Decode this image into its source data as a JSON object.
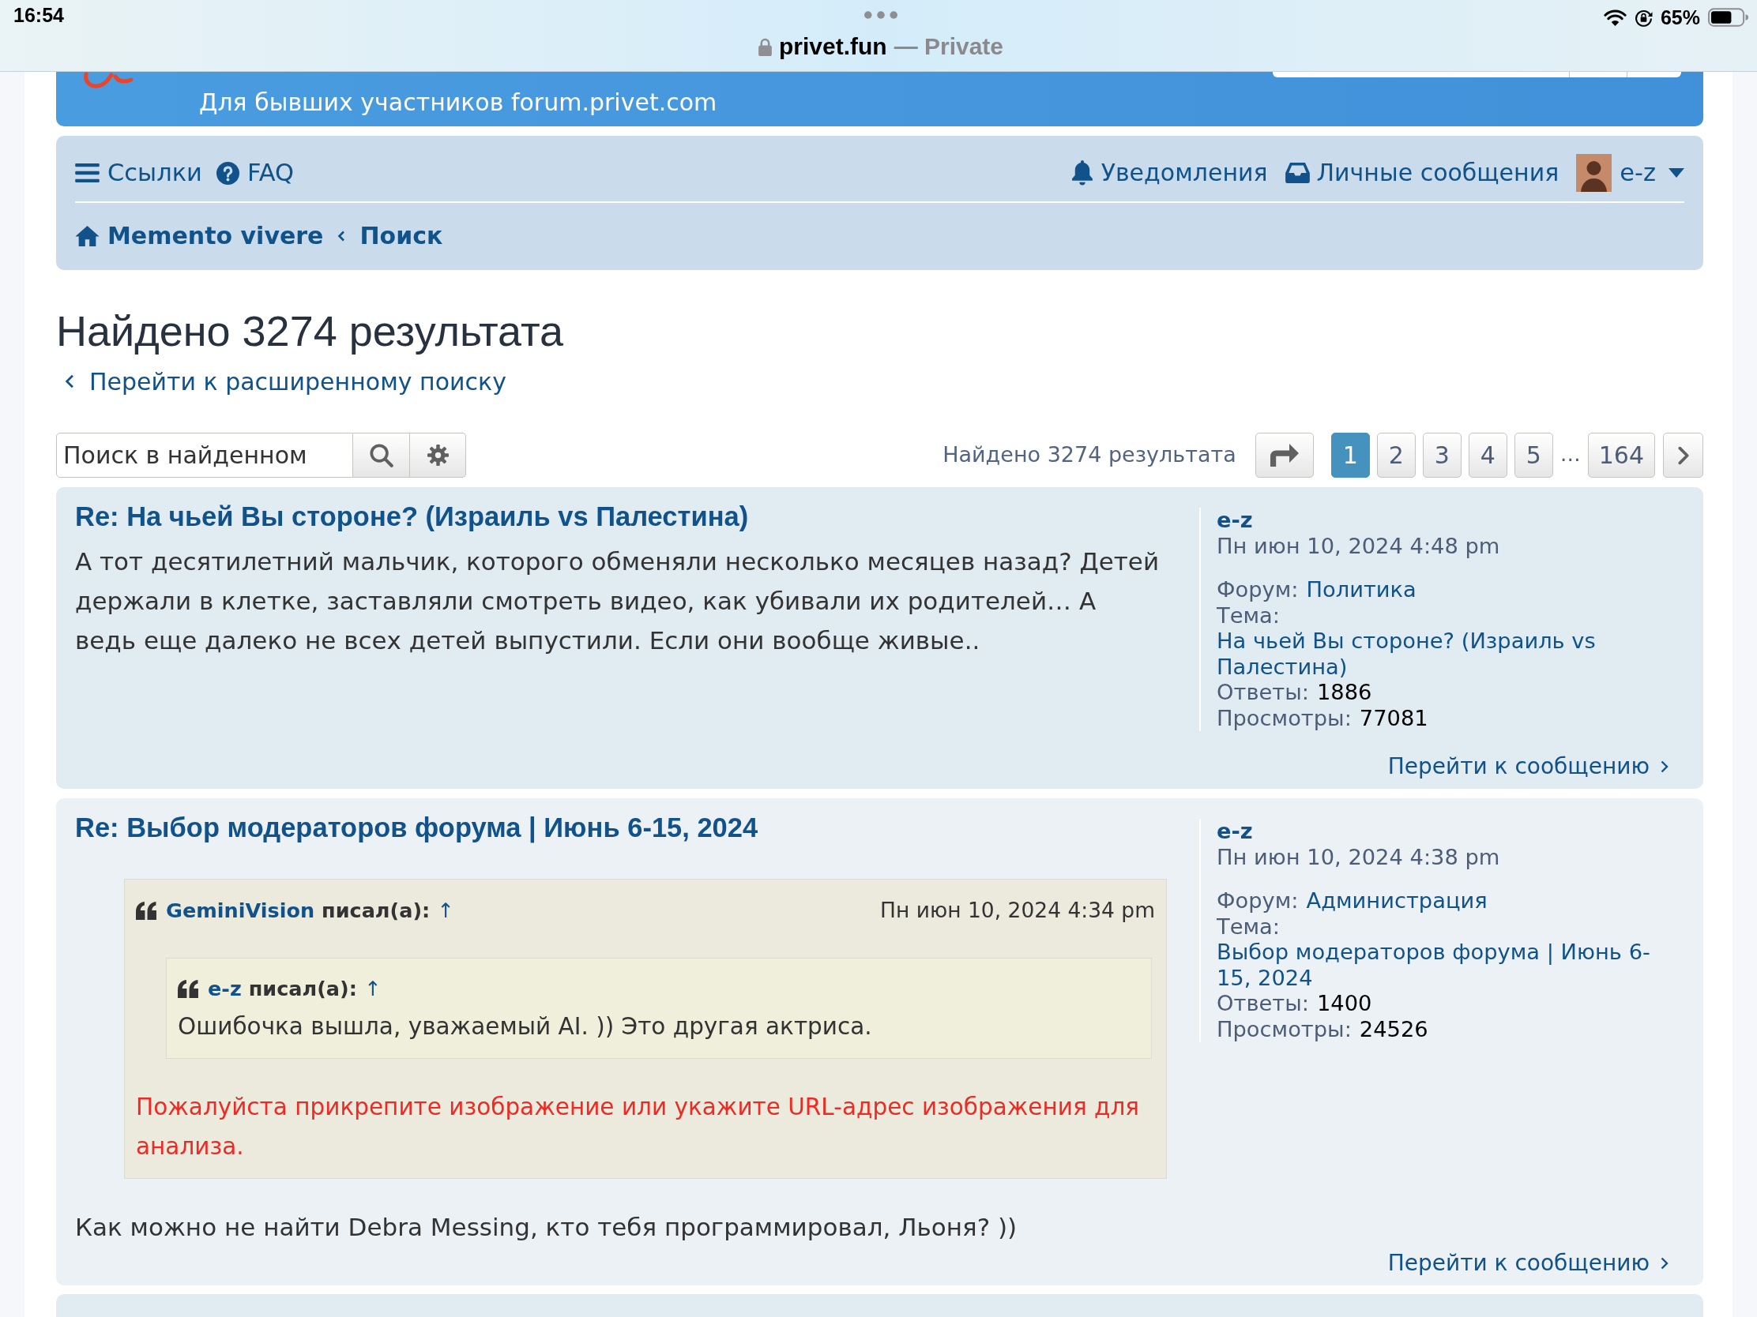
{
  "status_bar": {
    "time": "16:54",
    "battery": "65%"
  },
  "address_bar": {
    "domain": "privet.fun",
    "suffix": "— Private"
  },
  "header": {
    "tagline": "Для бывших участников forum.privet.com"
  },
  "navbar": {
    "left": [
      {
        "label": "Ссылки"
      },
      {
        "label": "FAQ"
      }
    ],
    "right": [
      {
        "label": "Уведомления"
      },
      {
        "label": "Личные сообщения"
      }
    ],
    "user": {
      "name": "e-z"
    },
    "breadcrumbs": [
      {
        "label": "Memento vivere"
      },
      {
        "label": "Поиск"
      }
    ]
  },
  "page": {
    "title": "Найдено 3274 результата",
    "advanced_search": "Перейти к расширенному поиску"
  },
  "search": {
    "placeholder": "Поиск в найденном"
  },
  "pagination": {
    "summary": "Найдено 3274 результата",
    "items": [
      {
        "kind": "page",
        "label": "1",
        "selected": true
      },
      {
        "kind": "page",
        "label": "2",
        "selected": false
      },
      {
        "kind": "page",
        "label": "3",
        "selected": false
      },
      {
        "kind": "page",
        "label": "4",
        "selected": false
      },
      {
        "kind": "page",
        "label": "5",
        "selected": false
      },
      {
        "kind": "ellipsis",
        "label": "…"
      },
      {
        "kind": "page",
        "label": "164",
        "selected": false
      }
    ]
  },
  "results": [
    {
      "title": "Re: На чьей Вы стороне? (Израиль vs Палестина)",
      "body": [
        {
          "kind": "text",
          "text": "А тот десятилетний мальчик, которого обменяли несколько месяцев назад? Детей держали в клетке, заставляли смотреть видео, как убивали их родителей… А ведь еще далеко не всех детей выпустили. Если они вообще живые.."
        }
      ],
      "author": "e-z",
      "date": "Пн июн 10, 2024 4:48 pm",
      "forum_label": "Форум:",
      "forum": "Политика",
      "topic_label": "Тема:",
      "topic": "На чьей Вы стороне? (Израиль vs Палестина)",
      "replies_label": "Ответы:",
      "replies": "1886",
      "views_label": "Просмотры:",
      "views": "77081",
      "jump": "Перейти к сообщению"
    },
    {
      "title": "Re: Выбор модераторов форума | Июнь 6-15, 2024",
      "body": [
        {
          "kind": "quote",
          "author": "GeminiVision",
          "wrote": "писал(а):",
          "arrow": "↑",
          "date": "Пн июн 10, 2024 4:34 pm",
          "content": [
            {
              "kind": "quote",
              "author": "e-z",
              "wrote": "писал(а):",
              "arrow": "↑",
              "content": [
                {
                  "kind": "text",
                  "text": "Ошибочка вышла, уважаемый AI. )) Это другая актриса."
                }
              ]
            },
            {
              "kind": "text",
              "text": "Пожалуйста прикрепите изображение или укажите URL-адрес изображения для анализа.",
              "color": "#ee2a24"
            }
          ]
        },
        {
          "kind": "text",
          "text": "Как можно не найти Debra Messing, кто тебя программировал, Льоня? ))"
        }
      ],
      "author": "e-z",
      "date": "Пн июн 10, 2024 4:38 pm",
      "forum_label": "Форум:",
      "forum": "Администрация",
      "topic_label": "Тема:",
      "topic": "Выбор модераторов форума | Июнь 6-15, 2024",
      "replies_label": "Ответы:",
      "replies": "1400",
      "views_label": "Просмотры:",
      "views": "24526",
      "jump": "Перейти к сообщению"
    }
  ]
}
